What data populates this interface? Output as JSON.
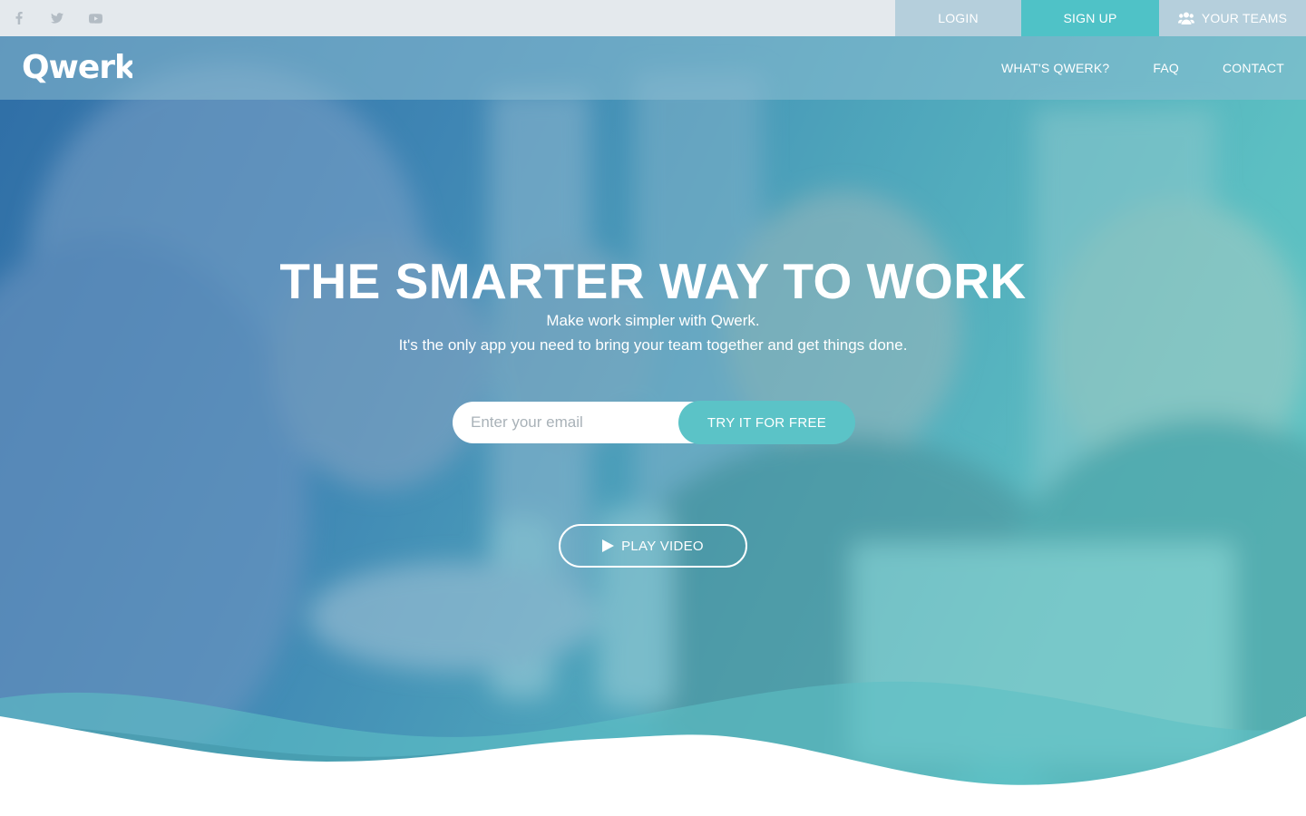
{
  "topbar": {
    "social": [
      {
        "icon": "facebook-icon"
      },
      {
        "icon": "twitter-icon"
      },
      {
        "icon": "youtube-icon"
      }
    ],
    "login_label": "LOGIN",
    "signup_label": "SIGN UP",
    "teams_label": "YOUR TEAMS",
    "teams_icon": "users-icon"
  },
  "navbar": {
    "logo_text": "Qwerk",
    "items": [
      {
        "label": "WHAT'S QWERK?"
      },
      {
        "label": "FAQ"
      },
      {
        "label": "CONTACT"
      }
    ]
  },
  "hero": {
    "title": "THE SMARTER WAY TO WORK",
    "subtitle_line1": "Make work simpler with Qwerk.",
    "subtitle_line2": "It's the only app you need to bring your team together and get things done.",
    "email_placeholder": "Enter your email",
    "email_value": "",
    "cta_label": "TRY IT FOR FREE",
    "play_label": "PLAY VIDEO",
    "play_icon": "play-icon"
  },
  "colors": {
    "accent": "#4fc2c7",
    "topbar_bg": "#e4e9ed",
    "topbar_link_bg": "#b5cfdc",
    "hero_blue": "#2f6ea6",
    "hero_teal": "#63c7c4"
  }
}
